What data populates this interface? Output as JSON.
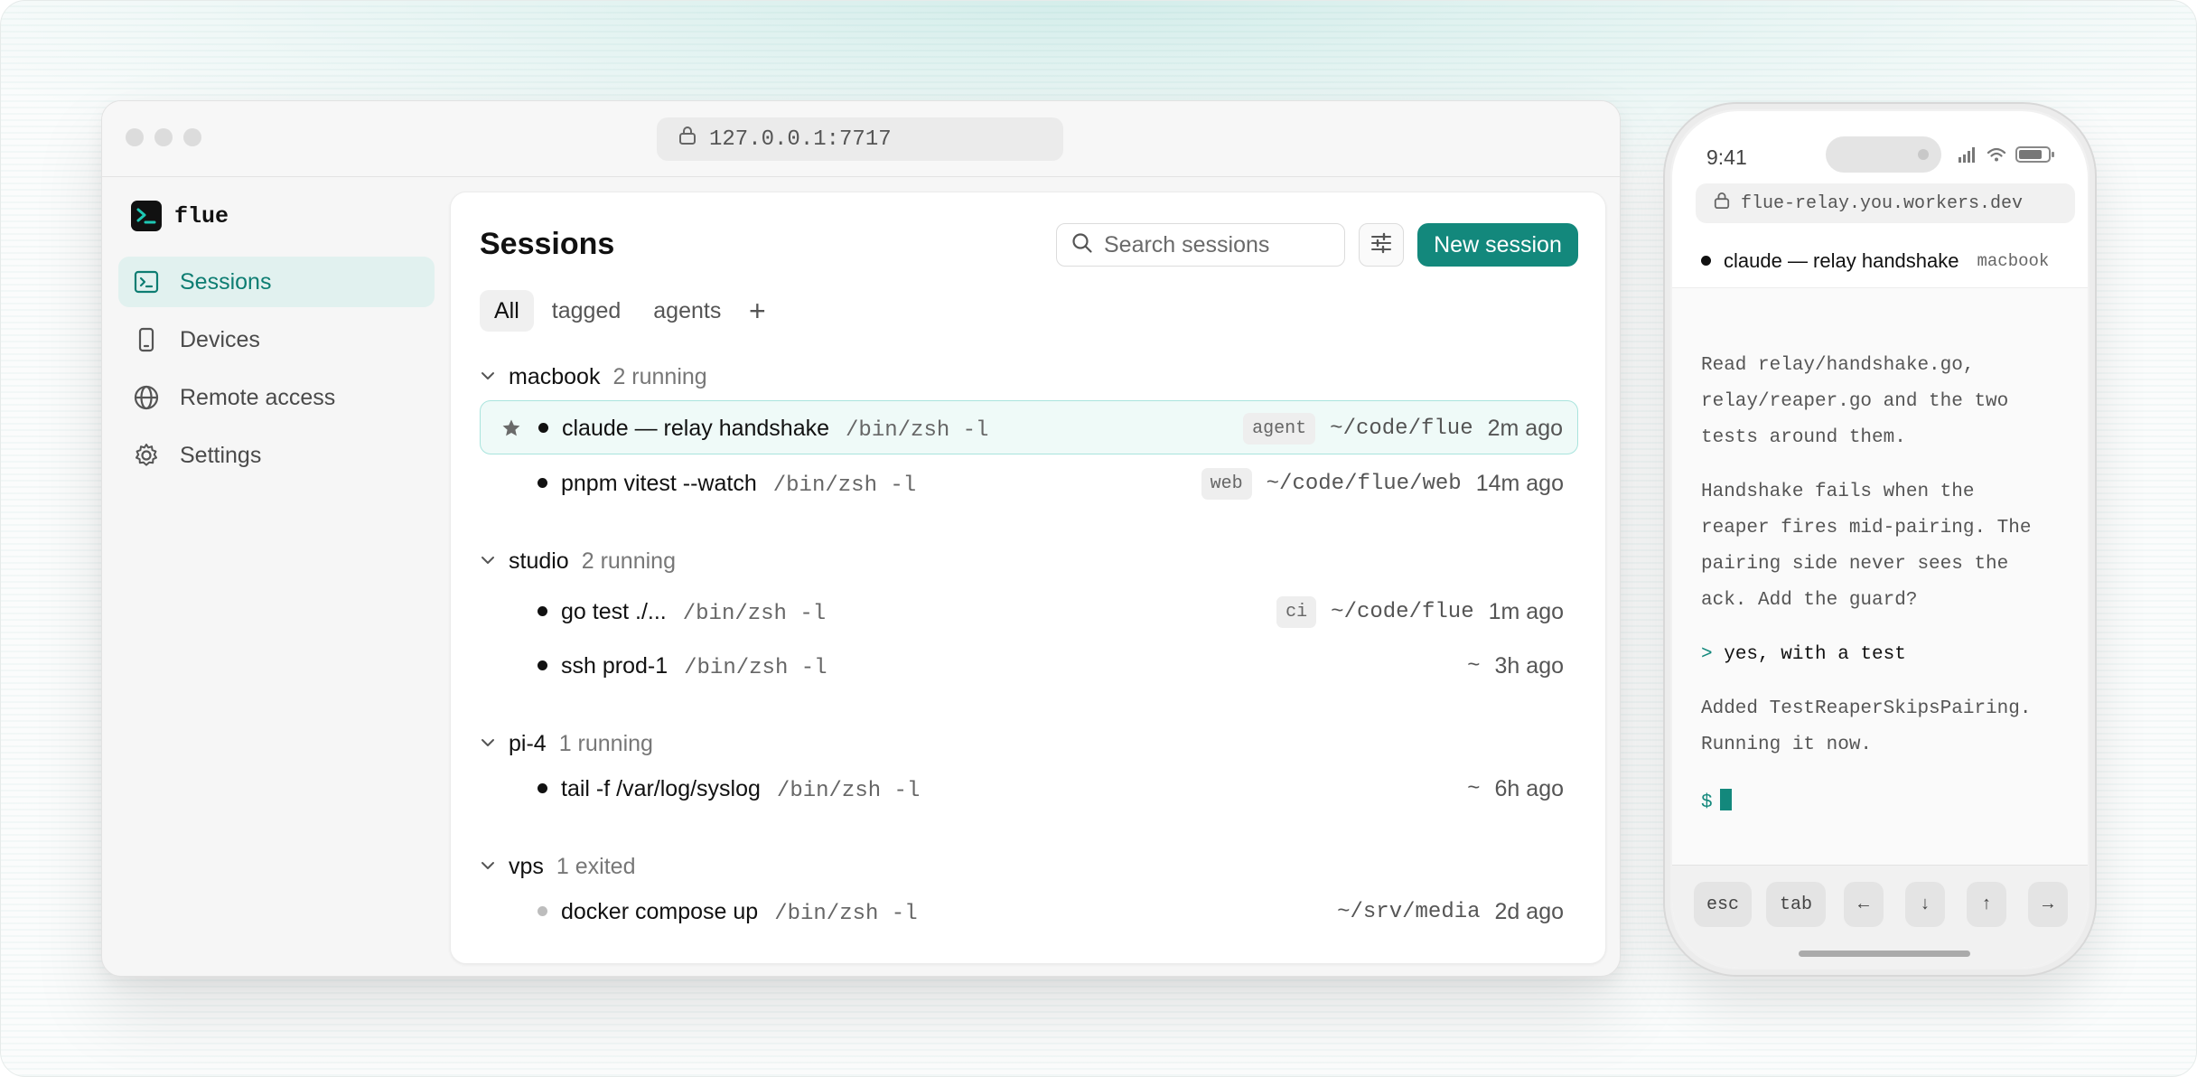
{
  "browser": {
    "url": "127.0.0.1:7717"
  },
  "app": {
    "brand": "flue",
    "nav": [
      {
        "label": "Sessions",
        "icon": "terminal-icon",
        "active": true
      },
      {
        "label": "Devices",
        "icon": "phone-icon",
        "active": false
      },
      {
        "label": "Remote access",
        "icon": "globe-icon",
        "active": false
      },
      {
        "label": "Settings",
        "icon": "gear-icon",
        "active": false
      }
    ],
    "accent_color": "#13887c"
  },
  "sessions": {
    "title": "Sessions",
    "search_placeholder": "Search sessions",
    "new_label": "New session",
    "tabs": [
      "All",
      "tagged",
      "agents"
    ],
    "add_tab": "+",
    "groups": [
      {
        "name": "macbook",
        "status": "2 running",
        "rows": [
          {
            "name": "claude — relay handshake",
            "shell": "/bin/zsh -l",
            "tag": "agent",
            "path": "~/code/flue",
            "time": "2m ago",
            "starred": true,
            "selected": true
          },
          {
            "name": "pnpm vitest --watch",
            "shell": "/bin/zsh -l",
            "tag": "web",
            "path": "~/code/flue/web",
            "time": "14m ago"
          }
        ]
      },
      {
        "name": "studio",
        "status": "2 running",
        "rows": [
          {
            "name": "go test ./...",
            "shell": "/bin/zsh -l",
            "tag": "ci",
            "path": "~/code/flue",
            "time": "1m ago"
          },
          {
            "name": "ssh prod-1",
            "shell": "/bin/zsh -l",
            "tag": "",
            "path": "~",
            "time": "3h ago"
          }
        ]
      },
      {
        "name": "pi-4",
        "status": "1 running",
        "rows": [
          {
            "name": "tail -f /var/log/syslog",
            "shell": "/bin/zsh -l",
            "tag": "",
            "path": "~",
            "time": "6h ago"
          }
        ]
      },
      {
        "name": "vps",
        "status": "1 exited",
        "rows": [
          {
            "name": "docker compose up",
            "shell": "/bin/zsh -l",
            "tag": "",
            "path": "~/srv/media",
            "time": "2d ago",
            "exited": true
          }
        ]
      }
    ]
  },
  "phone": {
    "time": "9:41",
    "url": "flue-relay.you.workers.dev",
    "session_title": "claude — relay handshake",
    "session_host": "macbook",
    "terminal": {
      "p1": [
        "Read relay/handshake.go,",
        "relay/reaper.go and the two",
        "tests around them."
      ],
      "p2": [
        "Handshake fails when the",
        "reaper fires mid-pairing. The",
        "pairing side never sees the",
        "ack. Add the guard?"
      ],
      "cmd_prompt": ">",
      "cmd": "yes, with a test",
      "p3": [
        "Added TestReaperSkipsPairing.",
        "Running it now."
      ],
      "shell_prompt": "$"
    },
    "keys": [
      "esc",
      "tab",
      "←",
      "↓",
      "↑",
      "→"
    ]
  }
}
